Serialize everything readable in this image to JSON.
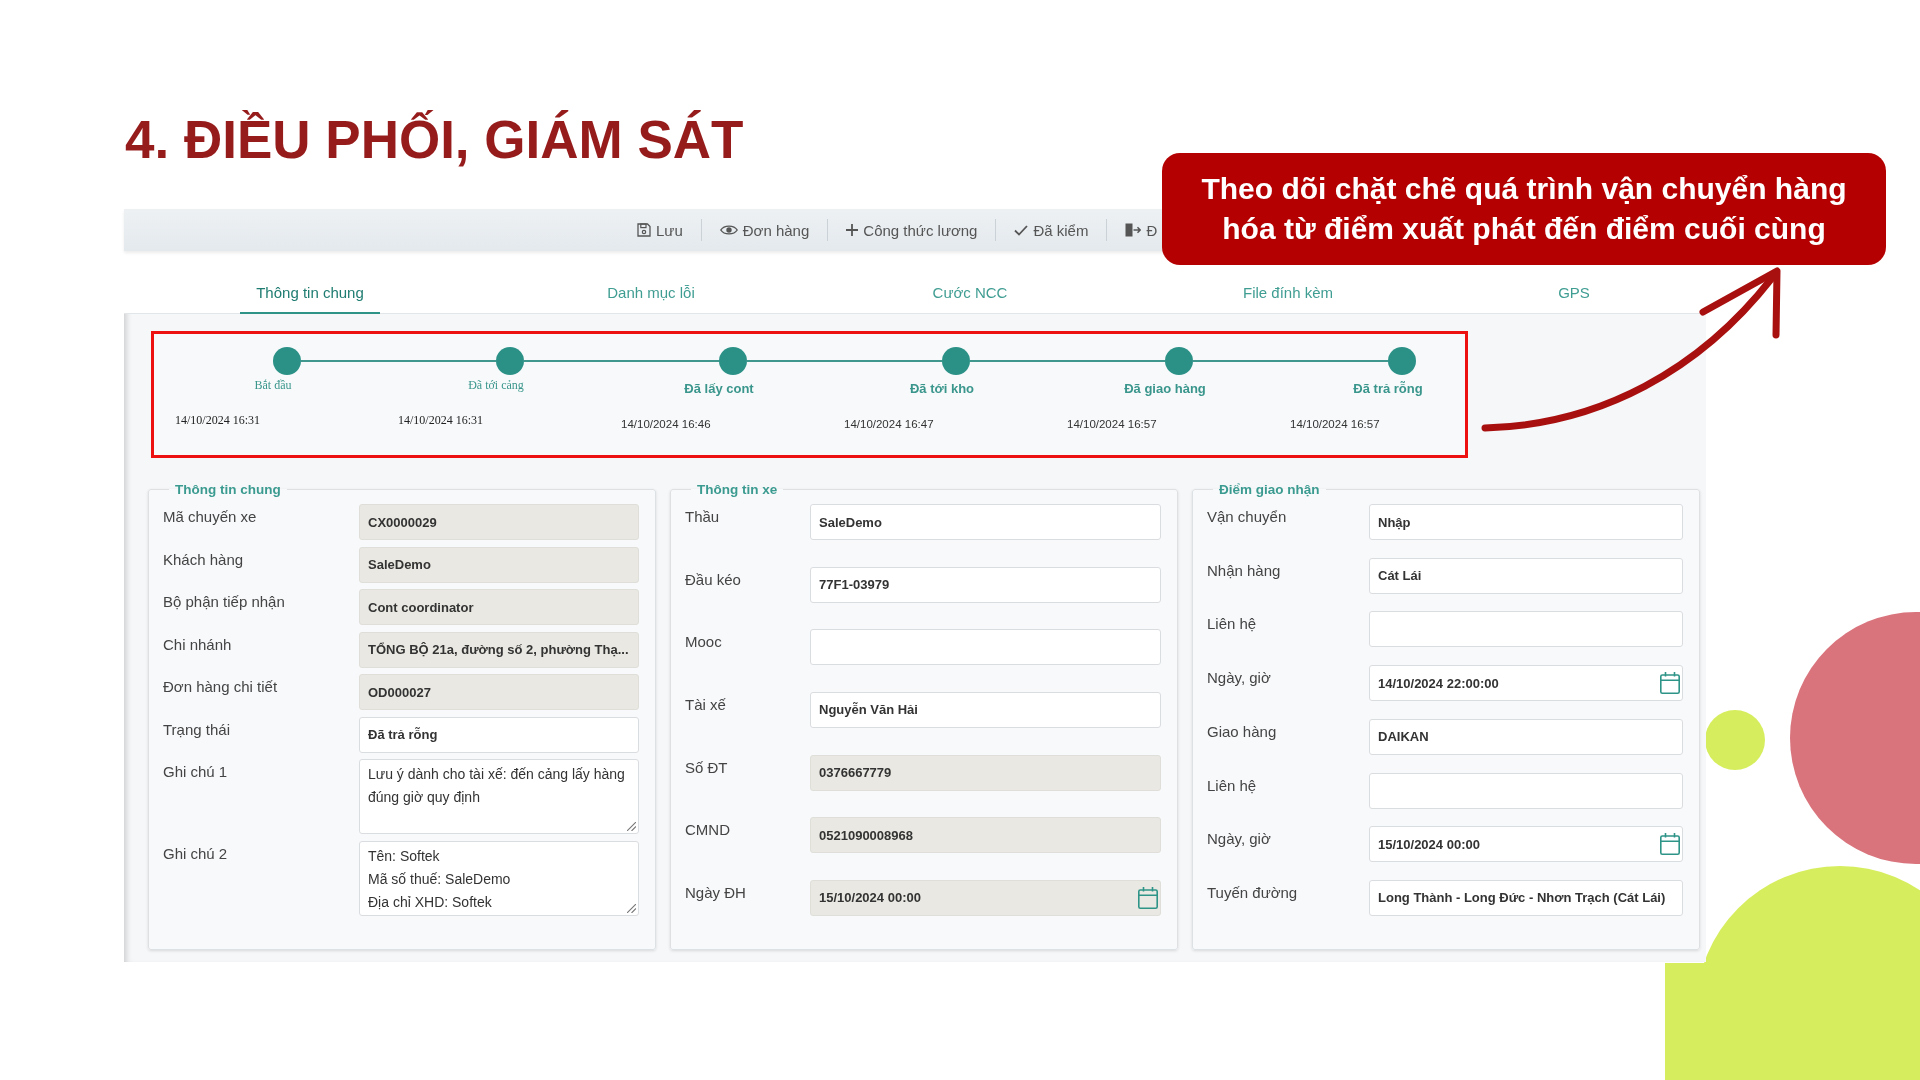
{
  "title": "4. ĐIỀU PHỐI, GIÁM SÁT",
  "callout": "Theo dõi chặt chẽ quá trình vận chuyển hàng hóa từ điểm xuất phát đến điểm cuối cùng",
  "toolbar": [
    {
      "kind": "save",
      "label": "Lưu"
    },
    {
      "kind": "view",
      "label": "Đơn hàng"
    },
    {
      "kind": "add",
      "label": "Công thức lương"
    },
    {
      "kind": "check",
      "label": "Đã kiểm"
    },
    {
      "kind": "exit",
      "label": "Đ"
    }
  ],
  "tabs": [
    {
      "label": "Thông tin chung",
      "selected": true
    },
    {
      "label": "Danh mục lỗi",
      "selected": false
    },
    {
      "label": "Cước NCC",
      "selected": false
    },
    {
      "label": "File đính kèm",
      "selected": false
    },
    {
      "label": "GPS",
      "selected": false
    }
  ],
  "timeline": [
    {
      "kind": "plain",
      "label": "Bắt đầu",
      "time": "14/10/2024 16:31"
    },
    {
      "kind": "plain",
      "label": "Đã tới cảng",
      "time": "14/10/2024 16:31"
    },
    {
      "kind": "strong",
      "label": "Đã lấy cont",
      "time": "14/10/2024 16:46"
    },
    {
      "kind": "strong",
      "label": "Đã tới kho",
      "time": "14/10/2024 16:47"
    },
    {
      "kind": "strong",
      "label": "Đã giao hàng",
      "time": "14/10/2024 16:57"
    },
    {
      "kind": "strong",
      "label": "Đã trả rỗng",
      "time": "14/10/2024 16:57"
    }
  ],
  "panels": [
    {
      "title": "Thông tin chung",
      "fields": [
        {
          "kind": "text",
          "label": "Mã chuyến xe",
          "value": "CX0000029",
          "disabled": true
        },
        {
          "kind": "text",
          "label": "Khách hàng",
          "value": "SaleDemo",
          "disabled": true
        },
        {
          "kind": "text",
          "label": "Bộ phận tiếp nhận",
          "value": "Cont coordinator",
          "disabled": true
        },
        {
          "kind": "text",
          "label": "Chi nhánh",
          "value": "TỔNG BỘ 21a, đường số 2, phường Thạ...",
          "disabled": true
        },
        {
          "kind": "text",
          "label": "Đơn hàng chi tiết",
          "value": "OD000027",
          "disabled": true
        },
        {
          "kind": "text",
          "label": "Trạng thái",
          "value": "Đã trả rỗng",
          "disabled": false
        },
        {
          "kind": "textarea",
          "label": "Ghi chú 1",
          "value": "Lưu ý dành cho tài xế: đến cảng lấy hàng đúng giờ quy định",
          "disabled": false
        },
        {
          "kind": "textarea",
          "label": "Ghi chú 2",
          "value": "Tên: Softek\nMã số thuế: SaleDemo\nĐịa chỉ XHD: Softek",
          "disabled": false
        }
      ]
    },
    {
      "title": "Thông tin xe",
      "fields": [
        {
          "kind": "text",
          "label": "Thầu",
          "value": "SaleDemo",
          "disabled": false
        },
        {
          "kind": "text",
          "label": "Đầu kéo",
          "value": "77F1-03979",
          "disabled": false
        },
        {
          "kind": "text",
          "label": "Mooc",
          "disabled": false
        },
        {
          "kind": "text",
          "label": "Tài xế",
          "value": "Nguyễn Văn Hải",
          "disabled": false
        },
        {
          "kind": "text",
          "label": "Số ĐT",
          "value": "0376667779",
          "disabled": true
        },
        {
          "kind": "text",
          "label": "CMND",
          "value": "0521090008968",
          "disabled": true
        },
        {
          "kind": "date",
          "label": "Ngày ĐH",
          "value": "15/10/2024 00:00",
          "disabled": true
        }
      ]
    },
    {
      "title": "Điểm giao nhận",
      "fields": [
        {
          "kind": "text",
          "label": "Vận chuyển",
          "value": "Nhập",
          "disabled": false
        },
        {
          "kind": "text",
          "label": "Nhận hàng",
          "value": "Cát Lái",
          "disabled": false
        },
        {
          "kind": "text",
          "label": "Liên hệ",
          "disabled": false
        },
        {
          "kind": "date",
          "label": "Ngày, giờ",
          "value": "14/10/2024 22:00:00",
          "disabled": false
        },
        {
          "kind": "text",
          "label": "Giao hàng",
          "value": "DAIKAN",
          "disabled": false
        },
        {
          "kind": "text",
          "label": "Liên hệ",
          "disabled": false
        },
        {
          "kind": "date",
          "label": "Ngày, giờ",
          "value": "15/10/2024 00:00",
          "disabled": false
        },
        {
          "kind": "text",
          "label": "Tuyến đường",
          "value": "Long Thành - Long Đức - Nhơn Trạch (Cát Lái)",
          "disabled": false
        }
      ]
    }
  ]
}
